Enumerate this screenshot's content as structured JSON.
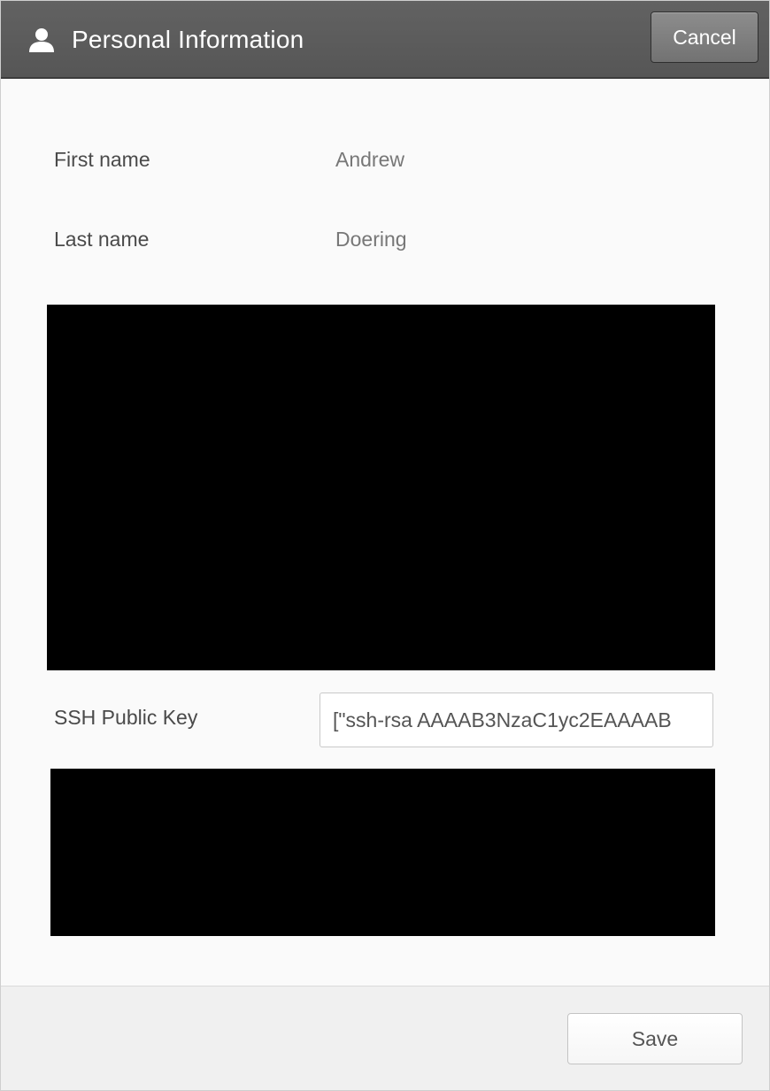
{
  "header": {
    "icon": "user-icon",
    "title": "Personal Information",
    "cancel_label": "Cancel"
  },
  "fields": {
    "first_name": {
      "label": "First name",
      "value": "Andrew"
    },
    "last_name": {
      "label": "Last name",
      "value": "Doering"
    },
    "ssh_key": {
      "label": "SSH Public Key",
      "value": "[\"ssh-rsa AAAAB3NzaC1yc2EAAAAB"
    }
  },
  "footer": {
    "save_label": "Save"
  },
  "colors": {
    "header_bg": "#5e5e5e",
    "redaction": "#000000"
  }
}
